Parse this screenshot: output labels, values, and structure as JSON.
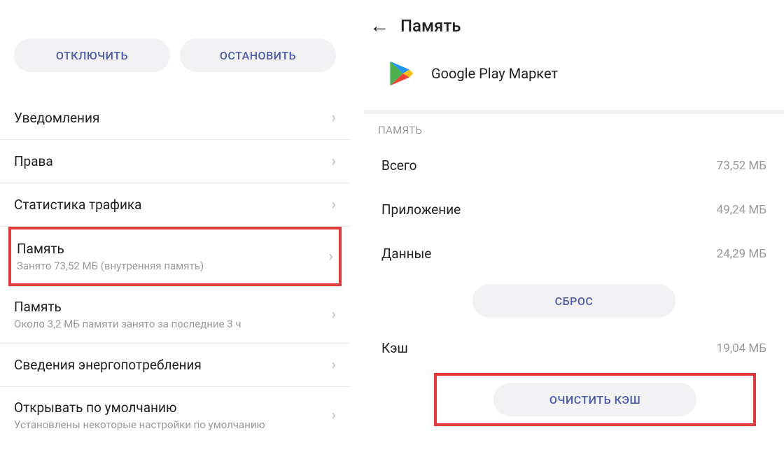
{
  "left": {
    "buttons": {
      "disable": "ОТКЛЮЧИТЬ",
      "stop": "ОСТАНОВИТЬ"
    },
    "items": [
      {
        "title": "Уведомления",
        "subtitle": null
      },
      {
        "title": "Права",
        "subtitle": null
      },
      {
        "title": "Статистика трафика",
        "subtitle": null
      },
      {
        "title": "Память",
        "subtitle": "Занято 73,52 МБ (внутренняя память)",
        "highlight": true
      },
      {
        "title": "Память",
        "subtitle": "Около 3,2 МБ памяти занято за последние 3 ч"
      },
      {
        "title": "Сведения энергопотребления",
        "subtitle": null
      },
      {
        "title": "Открывать по умолчанию",
        "subtitle": "Установлены некоторые настройки по умолчанию"
      }
    ]
  },
  "right": {
    "title": "Память",
    "app_name": "Google Play Маркет",
    "section": "ПАМЯТЬ",
    "rows": [
      {
        "label": "Всего",
        "value": "73,52 МБ"
      },
      {
        "label": "Приложение",
        "value": "49,24 МБ"
      },
      {
        "label": "Данные",
        "value": "24,29 МБ"
      }
    ],
    "reset_button": "СБРОС",
    "cache_row": {
      "label": "Кэш",
      "value": "19,04 МБ"
    },
    "clear_cache_button": "ОЧИСТИТЬ КЭШ"
  }
}
